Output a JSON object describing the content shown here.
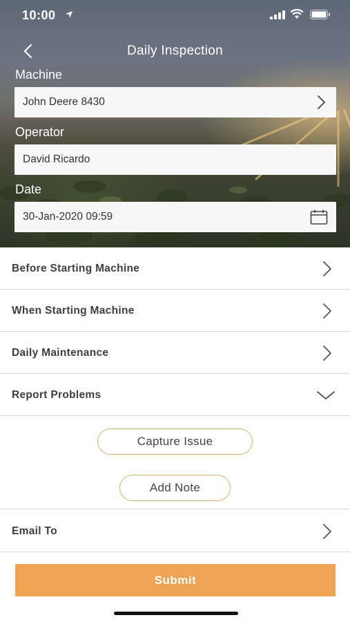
{
  "status_bar": {
    "time": "10:00"
  },
  "header": {
    "title": "Daily Inspection"
  },
  "form": {
    "machine_label": "Machine",
    "machine_value": "John Deere 8430",
    "operator_label": "Operator",
    "operator_value": "David Ricardo",
    "date_label": "Date",
    "date_value": "30-Jan-2020 09:59"
  },
  "sections": [
    {
      "label": "Before Starting Machine"
    },
    {
      "label": "When Starting Machine"
    },
    {
      "label": "Daily Maintenance"
    },
    {
      "label": "Report Problems",
      "expanded": true
    }
  ],
  "report_problems": {
    "capture_issue_label": "Capture Issue",
    "add_note_label": "Add Note"
  },
  "email_row": {
    "label": "Email To"
  },
  "submit_label": "Submit",
  "colors": {
    "accent": "#eda352",
    "pill_border": "#d6b26a",
    "divider": "#d6d6d6"
  }
}
